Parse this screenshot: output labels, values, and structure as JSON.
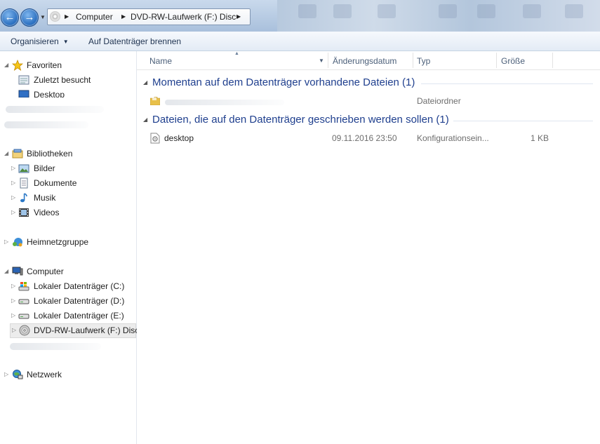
{
  "address": {
    "crumbs": [
      "Computer",
      "DVD-RW-Laufwerk (F:) Disc"
    ]
  },
  "toolbar": {
    "organize_label": "Organisieren",
    "burn_label": "Auf Datenträger brennen"
  },
  "nav": {
    "favorites": {
      "label": "Favoriten",
      "items": [
        "Zuletzt besucht",
        "Desktop"
      ]
    },
    "libraries": {
      "label": "Bibliotheken",
      "items": [
        "Bilder",
        "Dokumente",
        "Musik",
        "Videos"
      ]
    },
    "homegroup": {
      "label": "Heimnetzgruppe"
    },
    "computer": {
      "label": "Computer",
      "items": [
        "Lokaler Datenträger (C:)",
        "Lokaler Datenträger (D:)",
        "Lokaler Datenträger (E:)",
        "DVD-RW-Laufwerk (F:) Disc"
      ]
    },
    "network": {
      "label": "Netzwerk"
    }
  },
  "columns": {
    "name": "Name",
    "date": "Änderungsdatum",
    "type": "Typ",
    "size": "Größe"
  },
  "groups": [
    {
      "title": "Momentan auf dem Datenträger vorhandene Dateien (1)",
      "files": [
        {
          "name": "",
          "date": "",
          "type": "Dateiordner",
          "size": "",
          "icon": "folder-icon"
        }
      ]
    },
    {
      "title": "Dateien, die auf den Datenträger geschrieben werden sollen (1)",
      "files": [
        {
          "name": "desktop",
          "date": "09.11.2016 23:50",
          "type": "Konfigurationsein...",
          "size": "1 KB",
          "icon": "config-file-icon"
        }
      ]
    }
  ],
  "colors": {
    "group_title": "#1f3f8e",
    "selected_bg": "#ececec",
    "toolbar_bg": "#e3ebf5"
  }
}
